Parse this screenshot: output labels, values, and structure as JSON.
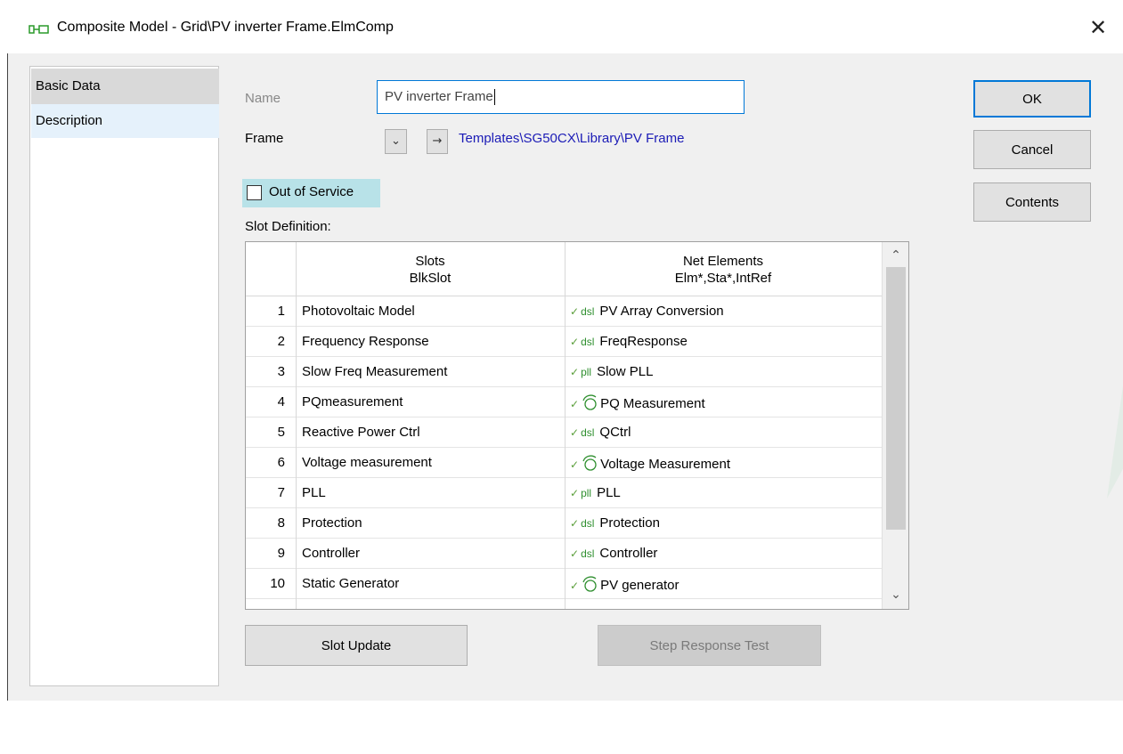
{
  "window": {
    "title": "Composite Model - Grid\\PV inverter Frame.ElmComp",
    "close_icon": "close-icon"
  },
  "nav": {
    "items": [
      {
        "label": "Basic Data",
        "selected": true
      },
      {
        "label": "Description",
        "selected": false
      }
    ]
  },
  "form": {
    "name_label": "Name",
    "name_value": "PV inverter Frame",
    "frame_label": "Frame",
    "frame_path": "Templates\\SG50CX\\Library\\PV Frame",
    "out_of_service_label": "Out of Service",
    "out_of_service_checked": false,
    "slot_definition_label": "Slot Definition:"
  },
  "table": {
    "headers": {
      "slots_line1": "Slots",
      "slots_line2": "BlkSlot",
      "net_line1": "Net Elements",
      "net_line2": "Elm*,Sta*,IntRef"
    },
    "rows": [
      {
        "num": "1",
        "slot": "Photovoltaic Model",
        "tag": "dsl",
        "net": "PV Array Conversion"
      },
      {
        "num": "2",
        "slot": "Frequency Response",
        "tag": "dsl",
        "net": "FreqResponse"
      },
      {
        "num": "3",
        "slot": "Slow Freq Measurement",
        "tag": "pll",
        "net": "Slow PLL"
      },
      {
        "num": "4",
        "slot": "PQmeasurement",
        "tag": "pq-measurement-icon",
        "net": "PQ Measurement"
      },
      {
        "num": "5",
        "slot": "Reactive Power Ctrl",
        "tag": "dsl",
        "net": "QCtrl"
      },
      {
        "num": "6",
        "slot": "Voltage measurement",
        "tag": "voltage-measurement-icon",
        "net": "Voltage Measurement"
      },
      {
        "num": "7",
        "slot": "PLL",
        "tag": "pll",
        "net": "PLL"
      },
      {
        "num": "8",
        "slot": "Protection",
        "tag": "dsl",
        "net": "Protection"
      },
      {
        "num": "9",
        "slot": "Controller",
        "tag": "dsl",
        "net": "Controller"
      },
      {
        "num": "10",
        "slot": "Static Generator",
        "tag": "pv-generator-icon",
        "net": "PV generator"
      }
    ]
  },
  "buttons": {
    "ok": "OK",
    "cancel": "Cancel",
    "contents": "Contents",
    "slot_update": "Slot Update",
    "step_response_test": "Step Response Test"
  },
  "colors": {
    "accent": "#0078d7",
    "link": "#1b1bb6",
    "highlight": "#b8e2e8",
    "dsl_tag": "#2f8f2f"
  }
}
